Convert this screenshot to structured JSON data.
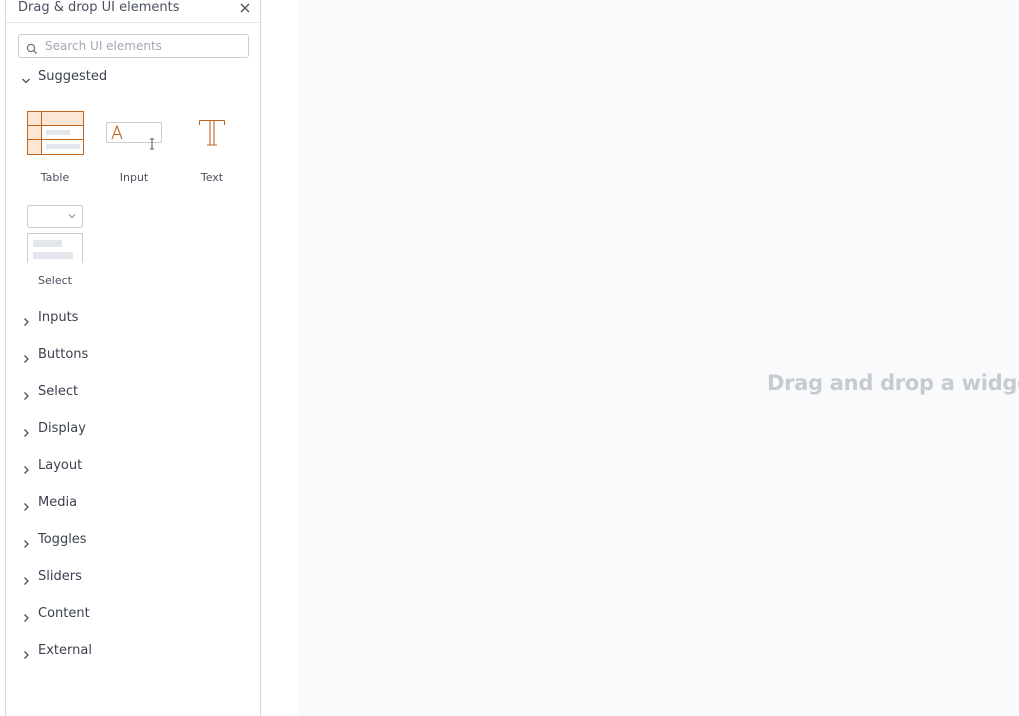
{
  "panel": {
    "title": "Drag & drop UI elements",
    "close_icon": "close-icon",
    "search": {
      "placeholder": "Search UI elements",
      "value": "",
      "icon": "search-icon"
    }
  },
  "suggested": {
    "label": "Suggested",
    "expanded": true,
    "widgets": [
      {
        "label": "Table",
        "icon": "table-widget-icon"
      },
      {
        "label": "Input",
        "icon": "input-widget-icon"
      },
      {
        "label": "Text",
        "icon": "text-widget-icon"
      },
      {
        "label": "Select",
        "icon": "select-widget-icon"
      }
    ]
  },
  "categories": [
    {
      "label": "Inputs"
    },
    {
      "label": "Buttons"
    },
    {
      "label": "Select"
    },
    {
      "label": "Display"
    },
    {
      "label": "Layout"
    },
    {
      "label": "Media"
    },
    {
      "label": "Toggles"
    },
    {
      "label": "Sliders"
    },
    {
      "label": "Content"
    },
    {
      "label": "External"
    }
  ],
  "canvas": {
    "placeholder": "Drag and drop a widge"
  },
  "colors": {
    "accent": "#c0651e",
    "accent_fill": "#fde6d4",
    "border": "#d4d7dd",
    "canvas_bg": "#f9fafb"
  }
}
